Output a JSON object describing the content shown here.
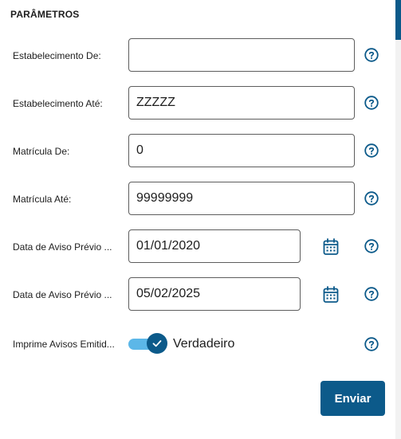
{
  "section": {
    "title": "PARÂMETROS"
  },
  "fields": [
    {
      "label": "Estabelecimento De:",
      "value": ""
    },
    {
      "label": "Estabelecimento Até:",
      "value": "ZZZZZ"
    },
    {
      "label": "Matrícula De:",
      "value": "0"
    },
    {
      "label": "Matrícula Até:",
      "value": "99999999"
    },
    {
      "label": "Data de Aviso Prévio ...",
      "value": "01/01/2020"
    },
    {
      "label": "Data de Aviso Prévio ...",
      "value": "05/02/2025"
    }
  ],
  "toggle": {
    "label": "Imprime Avisos Emitid...",
    "value_text": "Verdadeiro",
    "checked": true
  },
  "actions": {
    "submit_label": "Enviar"
  },
  "icons": {
    "help": "help-circle-icon",
    "calendar": "calendar-icon",
    "check": "check-icon"
  },
  "colors": {
    "primary": "#0c5a8a",
    "toggle_track": "#5cb7e8",
    "border": "#5d5d5d"
  }
}
